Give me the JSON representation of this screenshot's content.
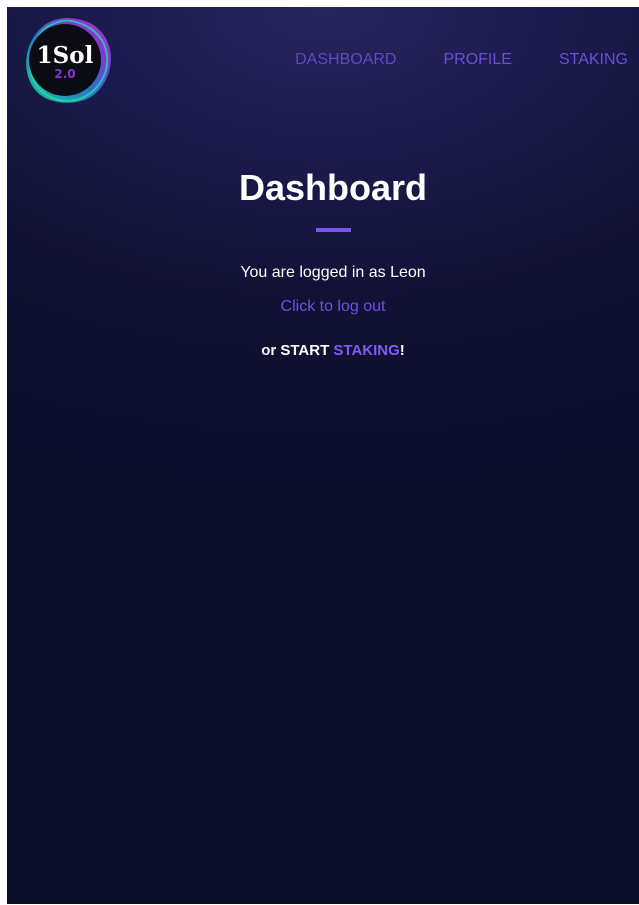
{
  "logo": {
    "name": "1Sol",
    "version": "2.0"
  },
  "nav": {
    "items": [
      {
        "label": "DASHBOARD"
      },
      {
        "label": "PROFILE"
      },
      {
        "label": "STAKING"
      }
    ]
  },
  "main": {
    "title": "Dashboard",
    "logged_in_text": "You are logged in as Leon",
    "logout_label": "Click to log out",
    "cta_prefix": "or START ",
    "cta_link": "STAKING",
    "cta_suffix": "!"
  },
  "colors": {
    "background": "#12123a",
    "accent": "#7b55f0",
    "nav_link": "#6b4ddc",
    "text": "#ffffff"
  }
}
